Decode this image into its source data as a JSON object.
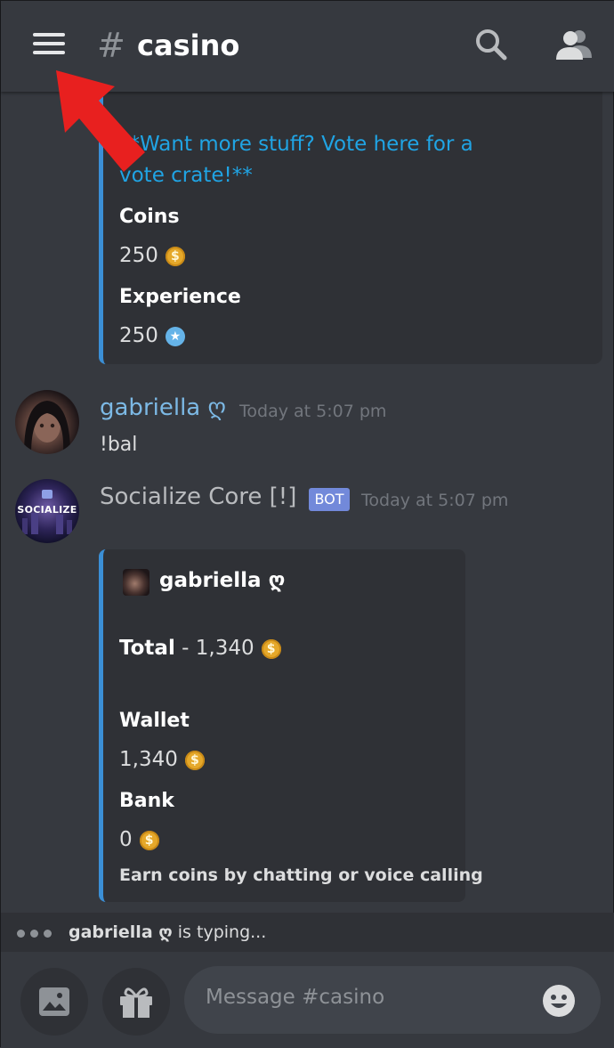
{
  "header": {
    "hash": "#",
    "channel": "casino"
  },
  "embed_top": {
    "link_line1": "**Want more stuff? Vote here for a",
    "link_line2": "vote crate!**",
    "field1_name": "Coins",
    "field1_value": "250",
    "field2_name": "Experience",
    "field2_value": "250"
  },
  "messages": [
    {
      "username": "gabriella ღ",
      "timestamp": "Today at 5:07 pm",
      "content": "!bal"
    },
    {
      "username": "Socialize Core [!]",
      "badge": "BOT",
      "timestamp": "Today at 5:07 pm",
      "avatar_text": "SOCIALIZE"
    }
  ],
  "embed_balance": {
    "author": "gabriella ღ",
    "total_label": "Total",
    "total_value": "- 1,340",
    "wallet_label": "Wallet",
    "wallet_value": "1,340",
    "bank_label": "Bank",
    "bank_value": "0",
    "footer": "Earn coins by chatting or voice calling"
  },
  "typing": {
    "user": "gabriella ღ",
    "text": "is typing..."
  },
  "composer": {
    "placeholder": "Message #casino"
  },
  "icons": {
    "coin": "$",
    "star": "★"
  },
  "colors": {
    "link": "#20a4e4",
    "embed_border": "#3b8fd6",
    "bot_badge": "#7289da",
    "annotation_arrow": "#e8201f"
  }
}
